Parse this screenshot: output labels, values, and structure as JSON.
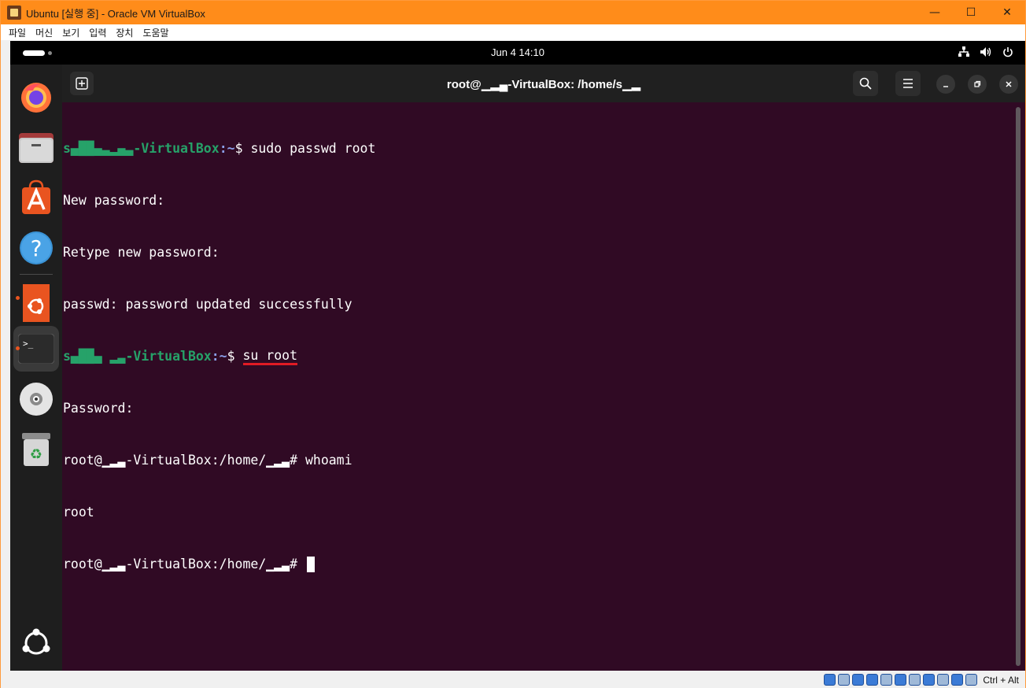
{
  "host": {
    "title": "Ubuntu [실행 중] - Oracle VM VirtualBox",
    "controls": {
      "minimize": "—",
      "maximize": "☐",
      "close": "✕"
    },
    "menu": [
      "파일",
      "머신",
      "보기",
      "입력",
      "장치",
      "도움말"
    ],
    "host_key": "Ctrl + Alt"
  },
  "topbar": {
    "clock": "Jun 4  14:10"
  },
  "dock": {
    "items": [
      "firefox",
      "files",
      "app-center",
      "help",
      "ubuntu-software",
      "terminal",
      "disc",
      "trash",
      "show-apps"
    ]
  },
  "terminal": {
    "title": "root@▁▂▄-VirtualBox: /home/s▁▂",
    "lines": [
      {
        "user": "s▄██▄▃▂▄▃-VirtualBox",
        "path": ":~",
        "sign": "$ ",
        "cmd": "sudo passwd root"
      },
      {
        "text": "New password:"
      },
      {
        "text": "Retype new password:"
      },
      {
        "text": "passwd: password updated successfully"
      },
      {
        "user": "s▄██▄ ▂▃-VirtualBox",
        "path": ":~",
        "sign": "$ ",
        "cmd": "su root"
      },
      {
        "text": "Password:"
      },
      {
        "text": "root@▁▂▃-VirtualBox:/home/▁▂▃# whoami"
      },
      {
        "text": "root"
      },
      {
        "text": "root@▁▂▃-VirtualBox:/home/▁▂▃# "
      }
    ]
  },
  "colors": {
    "terminal_bg": "#300a24",
    "prompt_user": "#26a269",
    "prompt_path": "#8a9ee8",
    "annotation": "#e01b24",
    "host_titlebar": "#ff8c1a"
  }
}
